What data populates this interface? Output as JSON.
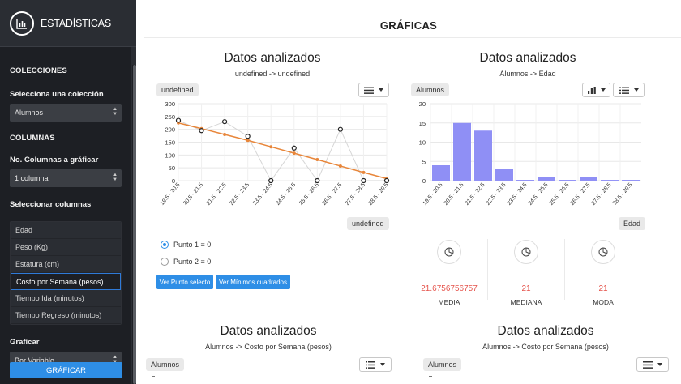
{
  "sidebar": {
    "title": "ESTADÍSTICAS",
    "colecciones_header": "COLECCIONES",
    "select_coleccion_label": "Selecciona una colección",
    "coleccion_value": "Alumnos",
    "columnas_header": "COLUMNAS",
    "num_columnas_label": "No. Columnas a gráficar",
    "num_columnas_value": "1 columna",
    "seleccionar_columnas_label": "Seleccionar columnas",
    "columns": [
      "Edad",
      "Peso (Kg)",
      "Estatura (cm)",
      "Costo por Semana (pesos)",
      "Tiempo Ida (minutos)",
      "Tiempo Regreso (minutos)"
    ],
    "active_column_index": 3,
    "graficar_label": "Graficar",
    "graficar_value": "Por Variable",
    "graficar_button": "GRÁFICAR"
  },
  "main": {
    "page_title": "GRÁFICAS",
    "panels": [
      {
        "title": "Datos analizados",
        "subtitle": "undefined -> undefined",
        "tag": "undefined",
        "axis_tag": "undefined"
      },
      {
        "title": "Datos analizados",
        "subtitle": "Alumnos -> Edad",
        "tag": "Alumnos",
        "axis_tag": "Edad"
      },
      {
        "title": "Datos analizados",
        "subtitle": "Alumnos -> Costo por Semana (pesos)",
        "tag": "Alumnos"
      },
      {
        "title": "Datos analizados",
        "subtitle": "Alumnos -> Costo por Semana (pesos)",
        "tag": "Alumnos"
      }
    ],
    "radios": [
      "Punto 1 = 0",
      "Punto 2 = 0"
    ],
    "btn_punto": "Ver Punto selecto",
    "btn_minimos": "Ver Mínimos cuadrados",
    "stats": [
      {
        "value": "21.6756756757",
        "label": "MEDIA"
      },
      {
        "value": "21",
        "label": "MEDIANA"
      },
      {
        "value": "21",
        "label": "MODA"
      }
    ]
  },
  "colors": {
    "accent": "#2e8ee6",
    "bar": "#8f8ff5",
    "trend": "#e8863a",
    "stat_value": "#e5534b",
    "sidebar_bg": "#1d1f24"
  },
  "chart_data": [
    {
      "type": "line",
      "categories": [
        "19.5 - 20.5",
        "20.5 - 21.5",
        "21.5 - 22.5",
        "22.5 - 23.5",
        "23.5 - 24.5",
        "24.5 - 25.5",
        "25.5 - 26.5",
        "26.5 - 27.5",
        "27.5 - 28.5",
        "28.5 - 29.5"
      ],
      "series": [
        {
          "values": [
            235,
            195,
            230,
            173,
            0,
            127,
            0,
            200,
            0,
            0
          ]
        },
        {
          "values": [
            225,
            203,
            180,
            157,
            132,
            107,
            82,
            57,
            32,
            8
          ]
        }
      ],
      "ylim": [
        0,
        300
      ],
      "yticks": [
        0,
        50,
        100,
        150,
        200,
        250,
        300
      ],
      "grid": true
    },
    {
      "type": "bar",
      "categories": [
        "19.5 - 20.5",
        "20.5 - 21.5",
        "21.5 - 22.5",
        "22.5 - 23.5",
        "23.5 - 24.5",
        "24.5 - 25.5",
        "25.5 - 26.5",
        "26.5 - 27.5",
        "27.5 - 28.5",
        "28.5 - 29.5"
      ],
      "values": [
        4,
        15,
        13,
        3,
        0.2,
        1,
        0.2,
        1,
        0.2,
        0.2
      ],
      "ylim": [
        0,
        20
      ],
      "yticks": [
        0,
        5,
        10,
        15,
        20
      ],
      "grid": true
    }
  ]
}
